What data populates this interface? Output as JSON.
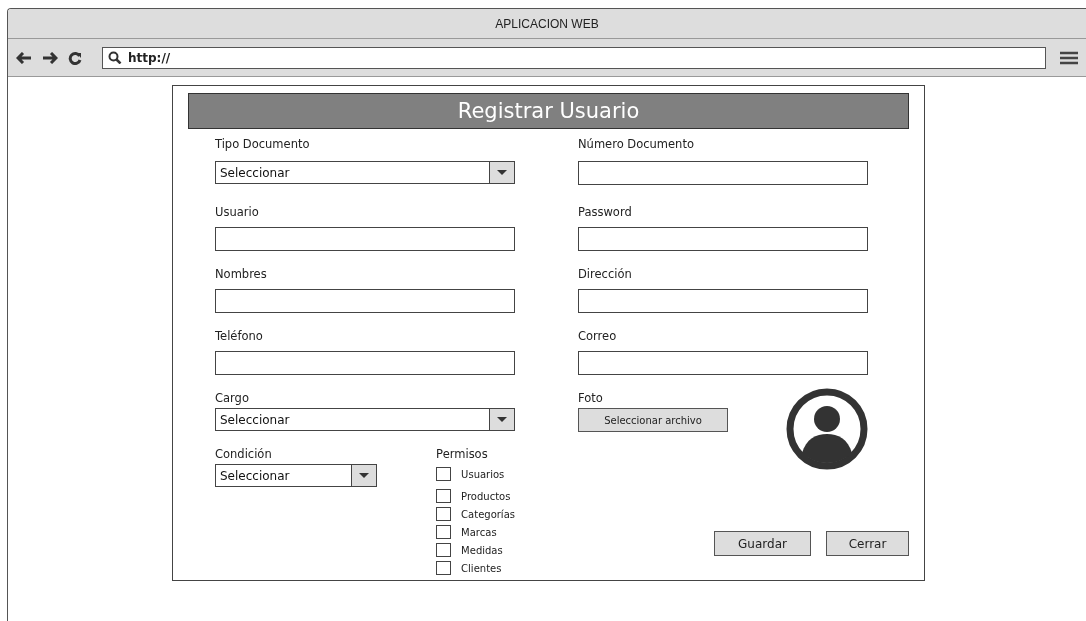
{
  "window": {
    "title": "APLICACION WEB"
  },
  "address_bar": {
    "value": "http://"
  },
  "dialog": {
    "title": "Registrar Usuario"
  },
  "fields": [
    {
      "label": "Tipo Documento",
      "kind": "select",
      "value": "Seleccionar"
    },
    {
      "label": "Número Documento",
      "kind": "text"
    },
    {
      "label": "Usuario",
      "kind": "text"
    },
    {
      "label": "Password",
      "kind": "text"
    },
    {
      "label": "Nombres",
      "kind": "text"
    },
    {
      "label": "Dirección",
      "kind": "text"
    },
    {
      "label": "Teléfono",
      "kind": "text"
    },
    {
      "label": "Correo",
      "kind": "text"
    }
  ],
  "cargo": {
    "label": "Cargo",
    "value": "Seleccionar"
  },
  "condicion": {
    "label": "Condición",
    "value": "Seleccionar"
  },
  "foto": {
    "label": "Foto",
    "button": "Seleccionar archivo"
  },
  "permisos": {
    "label": "Permisos",
    "items": [
      {
        "label": "Usuarios",
        "checked": false
      },
      {
        "label": "Productos",
        "checked": false
      },
      {
        "label": "Categorías",
        "checked": false
      },
      {
        "label": "Marcas",
        "checked": false
      },
      {
        "label": "Medidas",
        "checked": false
      },
      {
        "label": "Clientes",
        "checked": false
      }
    ]
  },
  "buttons": [
    "Guardar",
    "Cerrar"
  ]
}
